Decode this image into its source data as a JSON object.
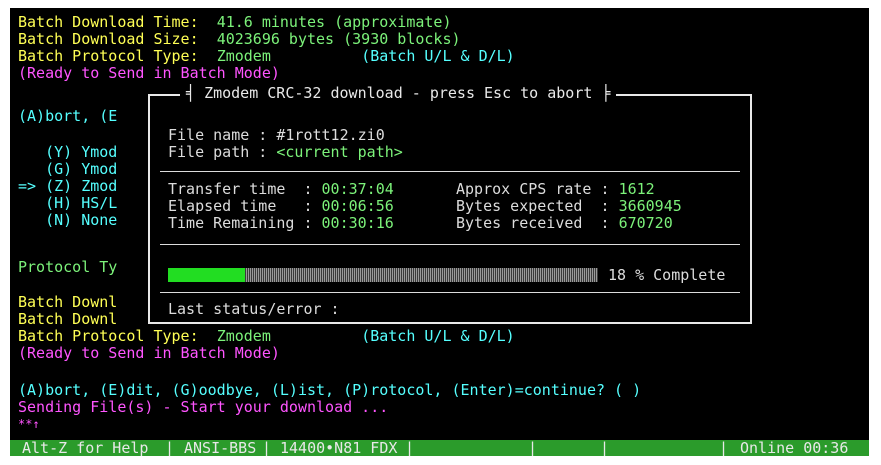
{
  "terminal": {
    "line1": {
      "label": "Batch Download Time:  ",
      "value": "41.6 minutes (approximate)"
    },
    "line2": {
      "label": "Batch Download Size:  ",
      "value": "4023696 bytes (3930 blocks)"
    },
    "line3": {
      "label": "Batch Protocol Type:  ",
      "value": "Zmodem",
      "note": "(Batch U/L & D/L)"
    },
    "line4": "(Ready to Send in Batch Mode)",
    "menu_partial": "(A)bort, (E",
    "proto_y": "   (Y) Ymod",
    "proto_g": "   (G) Ymod",
    "proto_z": "=> (Z) Zmod",
    "proto_h": "   (H) HS/L",
    "proto_n": "   (N) None",
    "proto_type_partial": "Protocol Ty",
    "batch_dl1": "Batch Downl",
    "batch_dl2": "Batch Downl",
    "line_proto2": {
      "label": "Batch Protocol Type:  ",
      "value": "Zmodem",
      "note": "(Batch U/L & D/L)"
    },
    "ready2": "(Ready to Send in Batch Mode)",
    "prompt": "(A)bort, (E)dit, (G)oodbye, (L)ist, (P)rotocol, (Enter)=continue? ( )",
    "sending": "Sending File(s) - Start your download ...",
    "cursor_line": "**↑"
  },
  "dialog": {
    "title": "Zmodem CRC-32 download - press Esc to abort",
    "file_name_label": "File name : ",
    "file_name": "#1rott12.zi0",
    "file_path_label": "File path : ",
    "file_path": "<current path>",
    "transfer_time_label": "Transfer time  : ",
    "transfer_time": "00:37:04",
    "elapsed_label": "Elapsed time   : ",
    "elapsed": "00:06:56",
    "remaining_label": "Time Remaining : ",
    "remaining": "00:30:16",
    "cps_label": "Approx CPS rate : ",
    "cps": "1612",
    "bytes_expected_label": "Bytes expected  : ",
    "bytes_expected": "3660945",
    "bytes_received_label": "Bytes received  : ",
    "bytes_received": "670720",
    "progress_fraction": 0.18,
    "progress_text": "18 % Complete",
    "last_status_label": "Last status/error :"
  },
  "statusbar": {
    "help": "Alt-Z for Help",
    "emulation": "ANSI-BBS",
    "connection": "14400•N81 FDX",
    "online": "Online 00:36"
  },
  "colors": {
    "background": "#000000",
    "label_yellow": "#ffff55",
    "value_green": "#7cf27a",
    "note_cyan": "#55ffff",
    "magenta": "#ff55ff",
    "progress_green": "#22dd22",
    "statusbar_green": "#2b9b2b"
  }
}
